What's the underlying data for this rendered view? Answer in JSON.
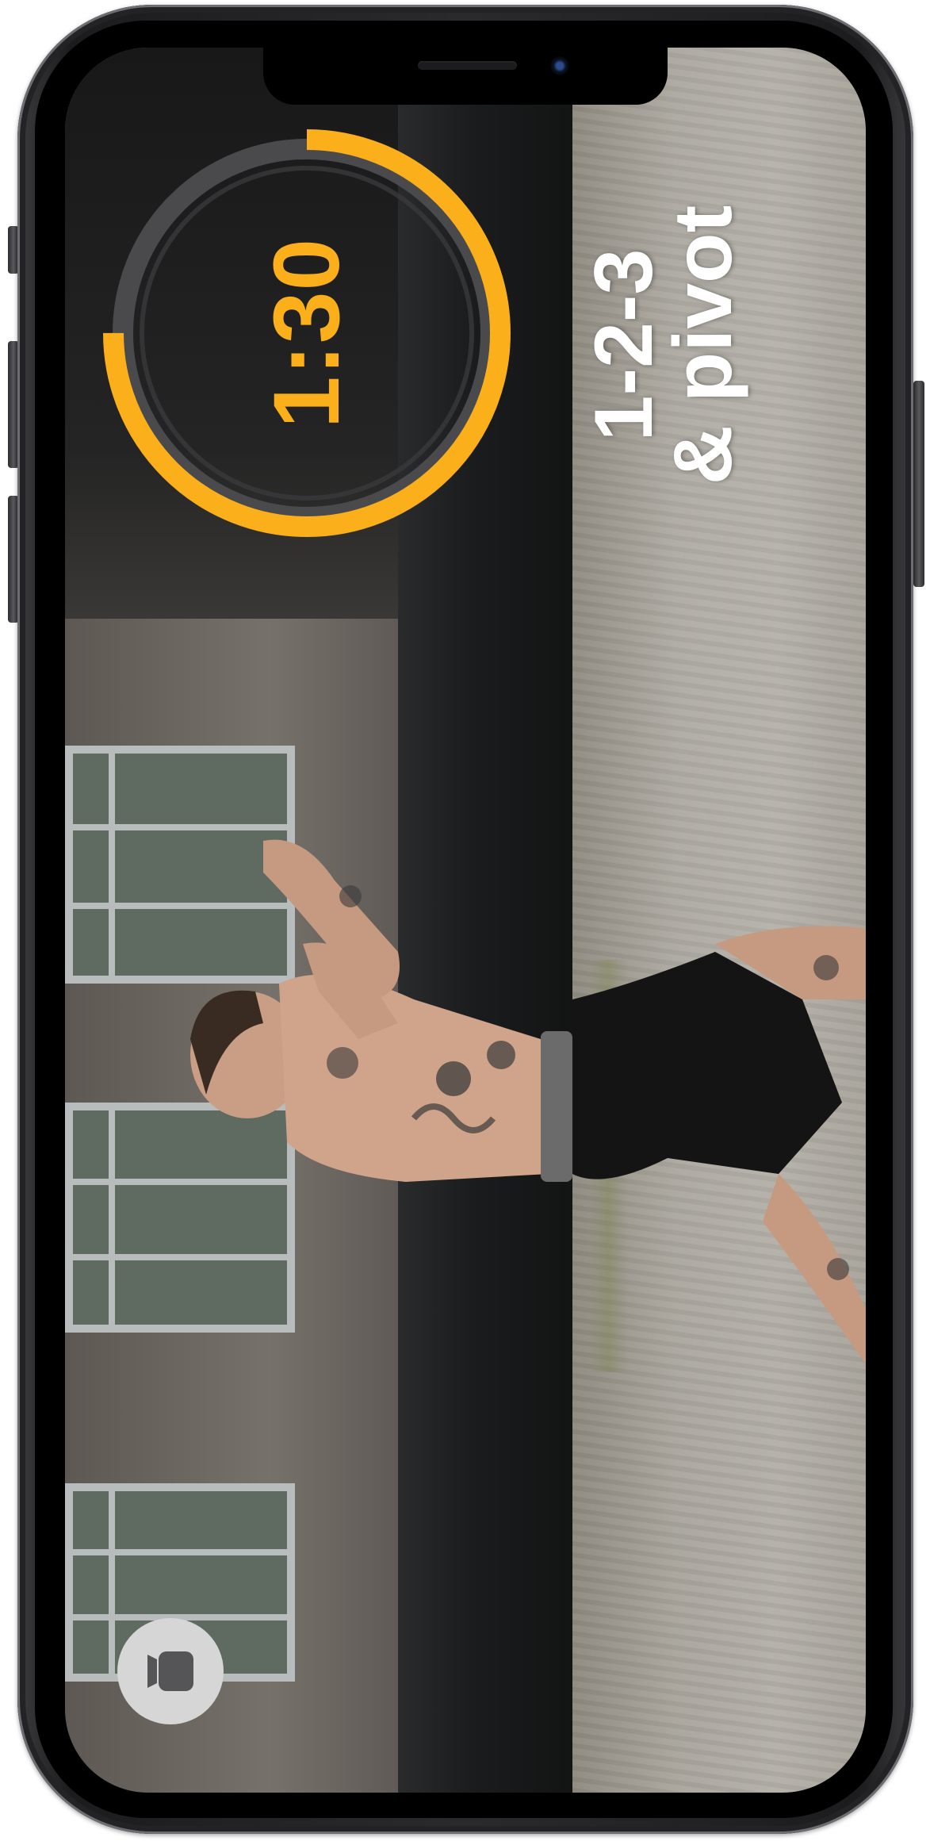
{
  "timer": {
    "time_label": "1:30",
    "progress_fraction": 0.75,
    "accent_color": "#fbaf1a",
    "track_color": "#4a4a4c"
  },
  "cue": {
    "line1": "1-2-3",
    "line2": "& pivot"
  },
  "controls": {
    "equipment_icon": "kettlebell-icon"
  },
  "device": {
    "frame": "phone-frame"
  }
}
